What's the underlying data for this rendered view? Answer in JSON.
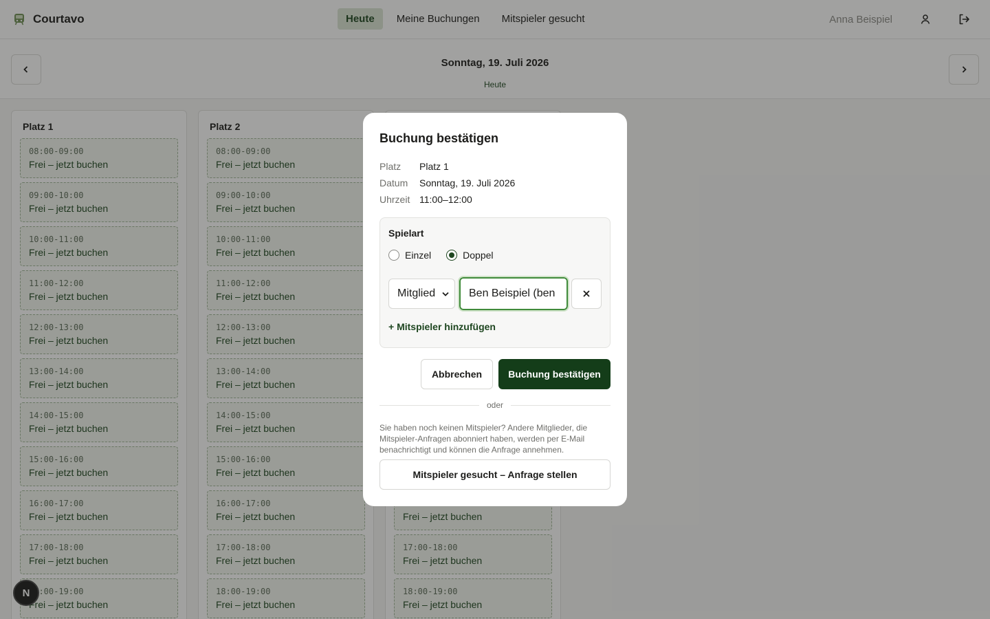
{
  "app": {
    "name": "Courtavo"
  },
  "nav": [
    {
      "label": "Heute",
      "active": true
    },
    {
      "label": "Meine Buchungen",
      "active": false
    },
    {
      "label": "Mitspieler gesucht",
      "active": false
    }
  ],
  "user": {
    "name": "Anna Beispiel"
  },
  "datebar": {
    "date": "Sonntag, 19. Juli 2026",
    "sub": "Heute"
  },
  "slot_label": "Frei – jetzt buchen",
  "courts": [
    {
      "name": "Platz 1",
      "slots": [
        "08:00-09:00",
        "09:00-10:00",
        "10:00-11:00",
        "11:00-12:00",
        "12:00-13:00",
        "13:00-14:00",
        "14:00-15:00",
        "15:00-16:00",
        "16:00-17:00",
        "17:00-18:00",
        "18:00-19:00"
      ]
    },
    {
      "name": "Platz 2",
      "slots": [
        "08:00-09:00",
        "09:00-10:00",
        "10:00-11:00",
        "11:00-12:00",
        "12:00-13:00",
        "13:00-14:00",
        "14:00-15:00",
        "15:00-16:00",
        "16:00-17:00",
        "17:00-18:00",
        "18:00-19:00"
      ]
    },
    {
      "name": "",
      "slots": [
        "",
        "",
        "",
        "",
        "",
        "",
        "",
        "",
        "",
        "17:00-18:00",
        "18:00-19:00"
      ]
    }
  ],
  "modal": {
    "title": "Buchung bestätigen",
    "details": [
      {
        "key": "Platz",
        "value": "Platz 1"
      },
      {
        "key": "Datum",
        "value": "Sonntag, 19. Juli 2026"
      },
      {
        "key": "Uhrzeit",
        "value": "11:00–12:00"
      }
    ],
    "spielart_label": "Spielart",
    "options": [
      {
        "label": "Einzel",
        "selected": false
      },
      {
        "label": "Doppel",
        "selected": true
      }
    ],
    "player_type": "Mitglied",
    "player_value": "Ben Beispiel (ben",
    "add_player": "+ Mitspieler hinzufügen",
    "cancel": "Abbrechen",
    "confirm": "Buchung bestätigen",
    "or": "oder",
    "hint": "Sie haben noch keinen Mitspieler? Andere Mitglieder, die Mitspieler-Anfragen abonniert haben, werden per E-Mail benachrichtigt und können die Anfrage annehmen.",
    "request": "Mitspieler gesucht – Anfrage stellen"
  },
  "dev_badge": "N",
  "colors": {
    "accent": "#1e4620",
    "accent_dark": "#143d19",
    "slot_bg": "#f3f7f0"
  }
}
